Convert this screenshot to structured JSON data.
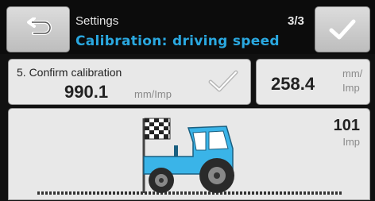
{
  "header": {
    "section": "Settings",
    "step": "3/3",
    "title": "Calibration: driving speed"
  },
  "buttons": {
    "back_icon": "back-arrow-icon",
    "ok_icon": "checkmark-icon"
  },
  "confirm": {
    "label": "5. Confirm calibration",
    "value": "990.1",
    "unit": "mm/Imp",
    "check_icon": "checkmark-icon"
  },
  "measure": {
    "value": "258.4",
    "unit_line1": "mm/",
    "unit_line2": "Imp"
  },
  "scene": {
    "count": "101",
    "unit": "Imp",
    "tractor_color": "#3ab4e8",
    "flag_icon": "checkered-flag-icon",
    "vehicle_icon": "tractor-icon"
  },
  "colors": {
    "accent": "#2aa8e0",
    "background": "#111111",
    "panel": "#e8e8e8"
  }
}
